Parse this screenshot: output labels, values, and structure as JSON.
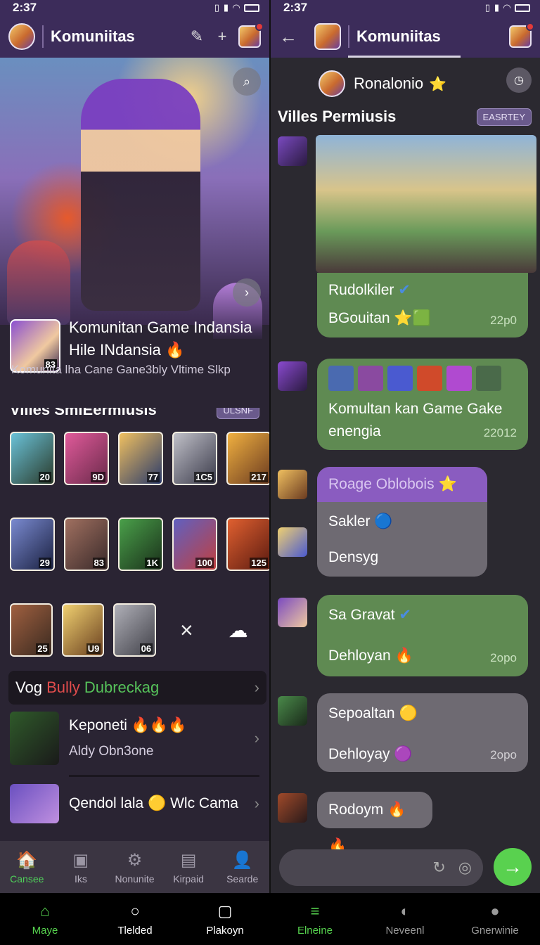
{
  "status": {
    "time": "2:37"
  },
  "left": {
    "appbar": {
      "title": "Komuniitas",
      "icons": [
        "pencil-icon",
        "plus-icon",
        "profile-icon"
      ]
    },
    "game": {
      "badge": "83",
      "title": "Komunitan Game Indansia Hile INdansia",
      "title_icon": "🔥",
      "description": "Komunita lha Cane Gane3bly Vltime Slkp"
    },
    "section": {
      "heading": "Villes SmlEermiusis",
      "pill": "ULSNF"
    },
    "heroes": [
      {
        "num": "20",
        "c1": "#6ac2d8",
        "c2": "#2a3a2a"
      },
      {
        "num": "9D",
        "c1": "#e05a9a",
        "c2": "#6a2a4a"
      },
      {
        "num": "77",
        "c1": "#f0c060",
        "c2": "#2a3a6a"
      },
      {
        "num": "1C5",
        "c1": "#c0c0c8",
        "c2": "#3a3a4a"
      },
      {
        "num": "217",
        "c1": "#f0b040",
        "c2": "#6a3a20"
      },
      {
        "num": "29",
        "c1": "#7a8ad0",
        "c2": "#1a2040"
      },
      {
        "num": "83",
        "c1": "#a07060",
        "c2": "#3a2a2a"
      },
      {
        "num": "1K",
        "c1": "#4aa04a",
        "c2": "#1a301a"
      },
      {
        "num": "100",
        "c1": "#6060c0",
        "c2": "#c04040"
      },
      {
        "num": "125",
        "c1": "#e06030",
        "c2": "#5a1a10"
      }
    ],
    "heroes_row3": [
      {
        "num": "25",
        "c1": "#a06040",
        "c2": "#3a2a20"
      },
      {
        "num": "U9",
        "c1": "#f0d070",
        "c2": "#6a4020"
      },
      {
        "num": "06",
        "c1": "#b0b0b8",
        "c2": "#404048"
      }
    ],
    "vog": {
      "part1": "Vog",
      "part2": "Bully",
      "part3": "Dubreckag"
    },
    "list": [
      {
        "title": "Keponeti",
        "emoji": "🔥🔥🔥",
        "subtitle": "Aldy Obn3one"
      },
      {
        "title": "Qendol lala",
        "emoji": "🟡",
        "title2": "Wlc Cama",
        "subtitle": ""
      }
    ],
    "bottom_tabs": [
      {
        "label": "Cansee",
        "icon": "🏠",
        "active": true
      },
      {
        "label": "Iks",
        "icon": "▣",
        "active": false
      },
      {
        "label": "Nonunite",
        "icon": "⚙",
        "active": false
      },
      {
        "label": "Kirpaid",
        "icon": "▤",
        "active": false
      },
      {
        "label": "Searde",
        "icon": "👤",
        "active": false
      }
    ]
  },
  "right": {
    "appbar": {
      "title": "Komuniitas"
    },
    "chat_head": {
      "name": "Ronalonio",
      "icon": "⭐"
    },
    "chat_sub": {
      "heading": "Villes Permiusis",
      "pill": "EASRTEY"
    },
    "messages": [
      {
        "line1": "Rudolkiler",
        "icon1": "✔",
        "line2": "BGouitan",
        "icon2": "⭐🟩",
        "time": "22p0"
      },
      {
        "line1": "Komultan kan Game Gake",
        "line2": "enengia",
        "time": "22012"
      },
      {
        "header": "Roage Oblobois",
        "header_icon": "⭐",
        "line1": "Sakler",
        "icon1": "🔵",
        "line2": "Densyg"
      },
      {
        "line1": "Sa Gravat",
        "icon1": "✔",
        "line2": "Dehloyan",
        "icon2": "🔥",
        "time": "2opo"
      },
      {
        "line1": "Sepoaltan",
        "icon1": "🟡",
        "line2": "Dehloyay",
        "icon2": "🟣",
        "time": "2opo"
      },
      {
        "line1": "Rodoym",
        "icon1": "🔥🔥"
      }
    ],
    "composer": {
      "icons": [
        "refresh-icon",
        "camera-icon"
      ]
    }
  },
  "global_nav": [
    {
      "label": "Maye",
      "icon": "⌂",
      "style": "green"
    },
    {
      "label": "Tlelded",
      "icon": "○",
      "style": "white"
    },
    {
      "label": "Plakoyn",
      "icon": "▢",
      "style": "white"
    },
    {
      "label": "Elneine",
      "icon": "≡",
      "style": "green"
    },
    {
      "label": "Neveenl",
      "icon": "◐",
      "style": "dim"
    },
    {
      "label": "Gnerwinie",
      "icon": "●",
      "style": "dim"
    }
  ]
}
